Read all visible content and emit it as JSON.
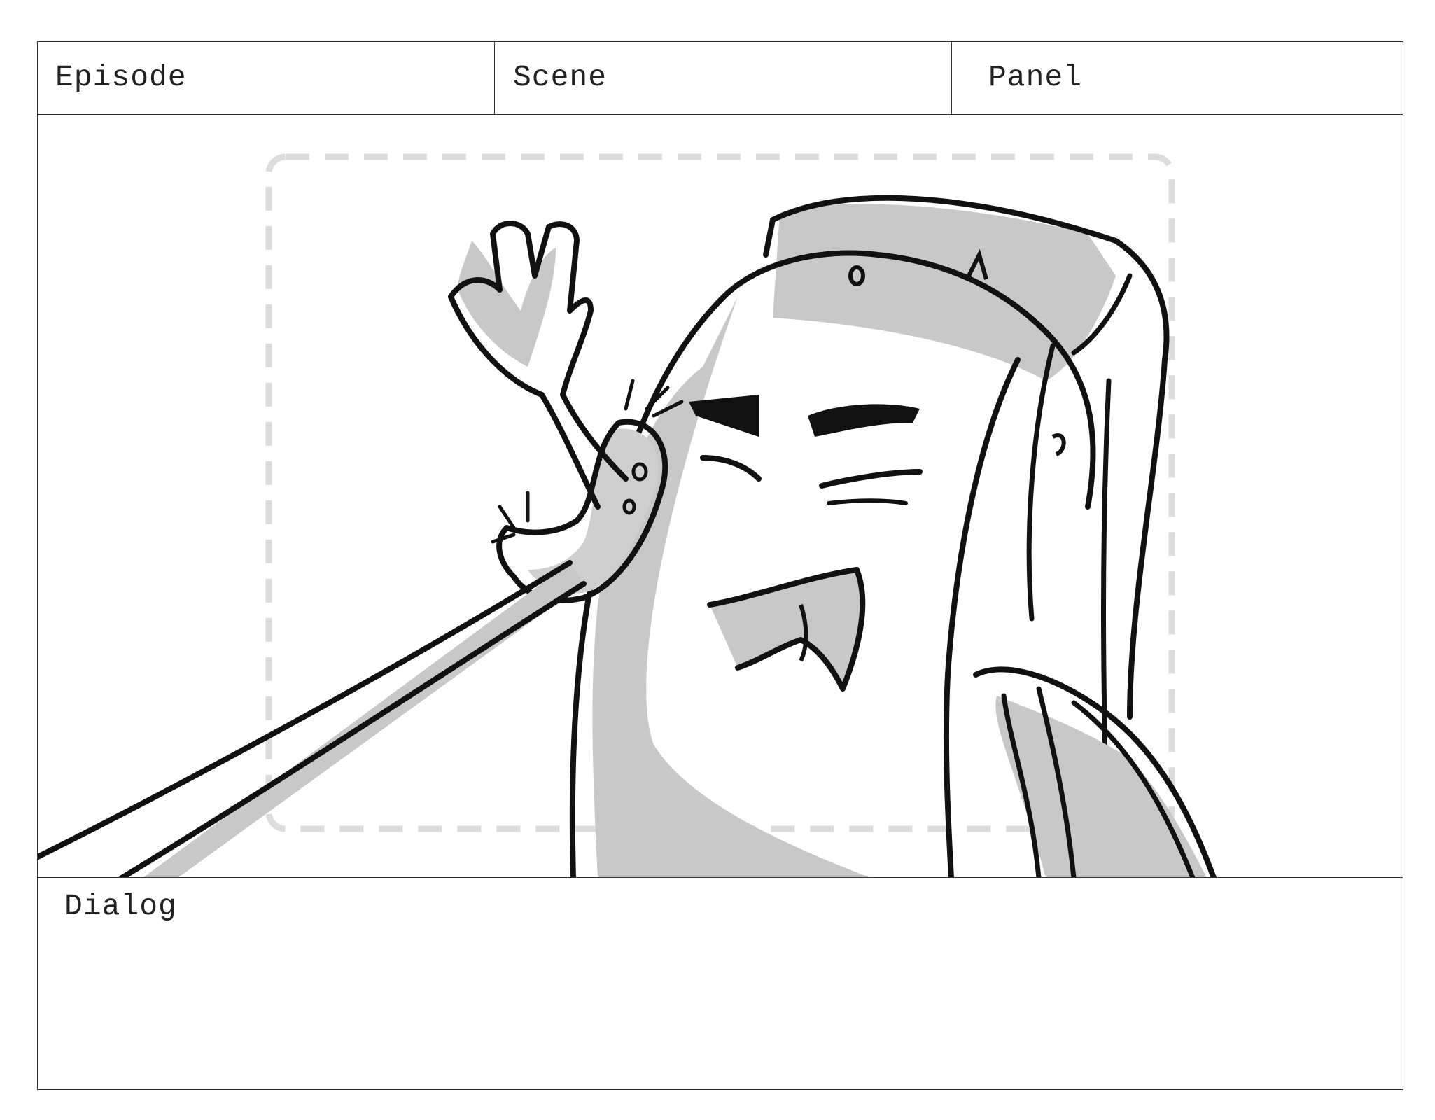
{
  "storyboard": {
    "header": {
      "episode_label": "Episode",
      "scene_label": "Scene",
      "panel_label": "Panel"
    },
    "dialog_label": "Dialog"
  }
}
